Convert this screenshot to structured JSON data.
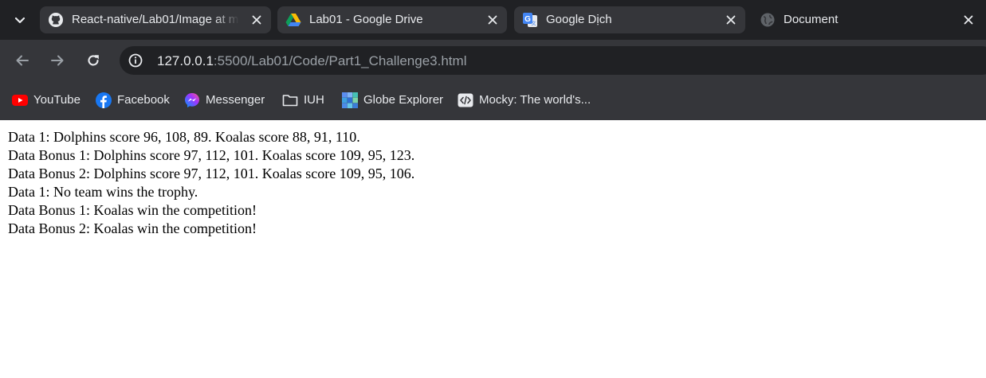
{
  "tabs": [
    {
      "title": "React-native/Lab01/Image at m",
      "icon": "github-icon"
    },
    {
      "title": "Lab01 - Google Drive",
      "icon": "google-drive-icon"
    },
    {
      "title": "Google Dịch",
      "icon": "google-translate-icon"
    },
    {
      "title": "Document",
      "icon": "globe-icon",
      "active": true
    }
  ],
  "address_bar": {
    "url_host": "127.0.0.1",
    "url_rest": ":5500/Lab01/Code/Part1_Challenge3.html"
  },
  "bookmarks": [
    {
      "label": "YouTube",
      "icon": "youtube-icon"
    },
    {
      "label": "Facebook",
      "icon": "facebook-icon"
    },
    {
      "label": "Messenger",
      "icon": "messenger-icon"
    },
    {
      "label": "IUH",
      "icon": "folder-icon"
    },
    {
      "label": "Globe Explorer",
      "icon": "globe-explorer-icon"
    },
    {
      "label": "Mocky: The world's...",
      "icon": "code-icon"
    }
  ],
  "page": {
    "lines": [
      "Data 1: Dolphins score 96, 108, 89. Koalas score 88, 91, 110.",
      "Data Bonus 1: Dolphins score 97, 112, 101. Koalas score 109, 95, 123.",
      "Data Bonus 2: Dolphins score 97, 112, 101. Koalas score 109, 95, 106.",
      "Data 1: No team wins the trophy.",
      "Data Bonus 1: Koalas win the competition!",
      "Data Bonus 2: Koalas win the competition!"
    ]
  },
  "colors": {
    "tabstrip_bg": "#202124",
    "toolbar_bg": "#35363a",
    "omnibox_bg": "#202124",
    "text_light": "#e8eaed",
    "text_dim": "#9aa0a6"
  }
}
